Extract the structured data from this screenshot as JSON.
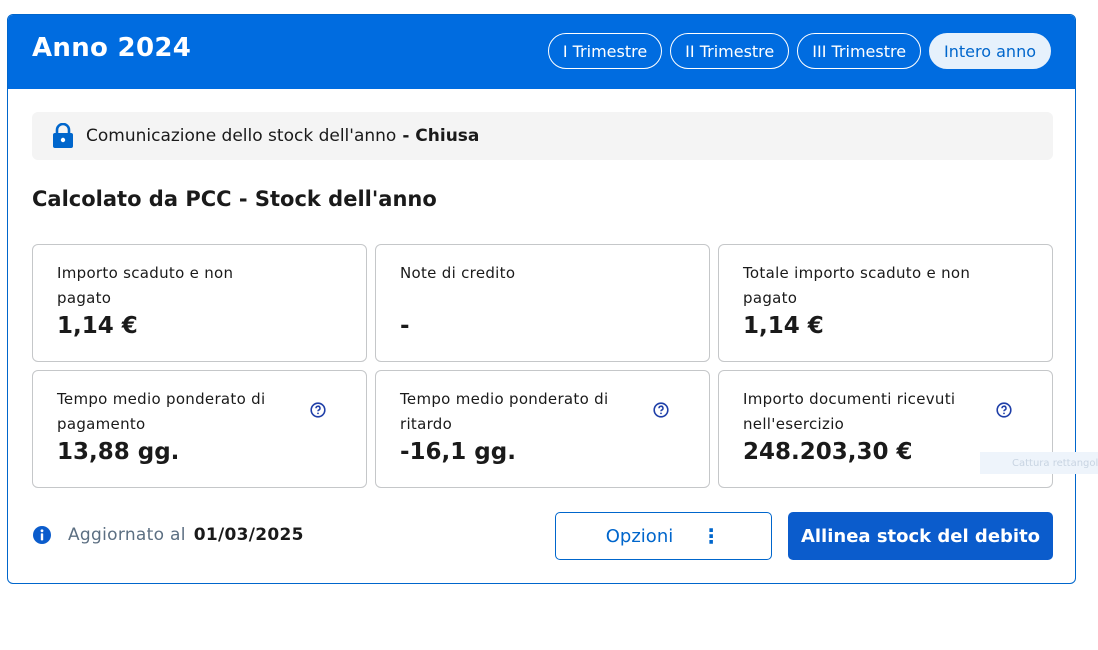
{
  "header": {
    "title": "Anno 2024",
    "tabs": [
      {
        "label": "I Trimestre",
        "active": false
      },
      {
        "label": "II Trimestre",
        "active": false
      },
      {
        "label": "III Trimestre",
        "active": false
      },
      {
        "label": "Intero anno",
        "active": true
      }
    ]
  },
  "notice": {
    "text": "Comunicazione dello stock dell'anno",
    "status": "- Chiusa",
    "icon": "lock-icon"
  },
  "section": {
    "title": "Calcolato da PCC - Stock dell'anno"
  },
  "metrics": [
    {
      "label": "Importo scaduto e non pagato",
      "value": "1,14 €"
    },
    {
      "label": "Note di credito",
      "value": "-"
    },
    {
      "label": "Totale importo scaduto e non pagato",
      "value": "1,14 €"
    },
    {
      "label": "Tempo medio ponderato di pagamento",
      "value": "13,88 gg.",
      "help": true
    },
    {
      "label": "Tempo medio ponderato di ritardo",
      "value": "-16,1 gg.",
      "help": true
    },
    {
      "label": "Importo documenti ricevuti nell'esercizio",
      "value": "248.203,30 €",
      "help": true
    }
  ],
  "footer": {
    "updated_label": "Aggiornato al",
    "updated_date": "01/03/2025",
    "options_label": "Opzioni",
    "primary_label": "Allinea stock del debito"
  },
  "overlay": {
    "capture_label": "Cattura rettangolare"
  },
  "colors": {
    "primary": "#0066cc",
    "header_bg": "#006ce0",
    "button_bg": "#0b5ccc",
    "notice_bg": "#f4f4f4",
    "border": "#c5c7c9"
  }
}
